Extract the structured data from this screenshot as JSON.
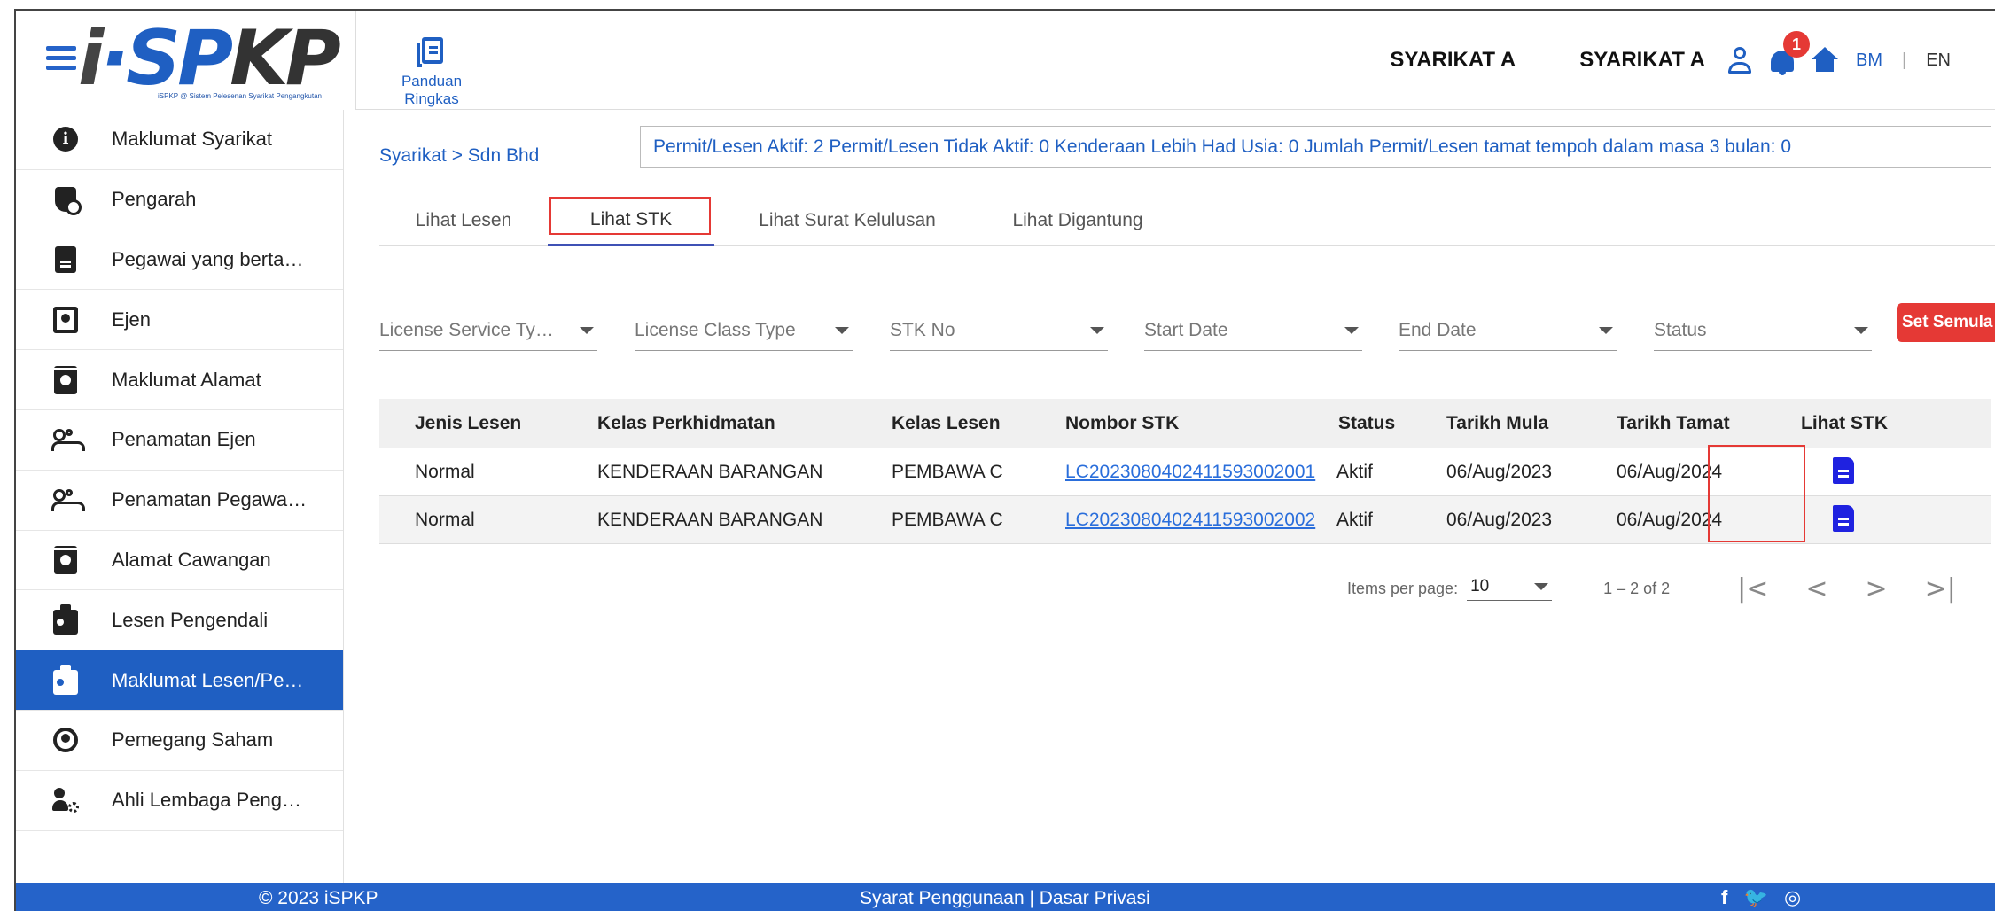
{
  "header": {
    "logo": "iSPKP",
    "logo_sub": "iSPKP @ Sistem Pelesenan Syarikat Pengangkutan",
    "guide_label": "Panduan Ringkas",
    "company_1": "SYARIKAT A",
    "company_2": "SYARIKAT A",
    "notification_count": "1",
    "lang_bm": "BM",
    "lang_sep": "|",
    "lang_en": "EN"
  },
  "sidebar": {
    "items": [
      {
        "label": "Maklumat Syarikat",
        "icon": "info-icon"
      },
      {
        "label": "Pengarah",
        "icon": "shield-user-icon"
      },
      {
        "label": "Pegawai yang berta…",
        "icon": "document-person-icon"
      },
      {
        "label": "Ejen",
        "icon": "contact-card-icon"
      },
      {
        "label": "Maklumat Alamat",
        "icon": "badge-icon"
      },
      {
        "label": "Penamatan Ejen",
        "icon": "people-icon"
      },
      {
        "label": "Penamatan Pegawa…",
        "icon": "people-icon"
      },
      {
        "label": "Alamat Cawangan",
        "icon": "badge-icon"
      },
      {
        "label": "Lesen Pengendali",
        "icon": "id-badge-icon"
      },
      {
        "label": "Maklumat Lesen/Pe…",
        "icon": "id-badge-icon",
        "active": true
      },
      {
        "label": "Pemegang Saham",
        "icon": "person-circle-icon"
      },
      {
        "label": "Ahli Lembaga Peng…",
        "icon": "user-gear-icon"
      }
    ]
  },
  "main": {
    "breadcrumb": "Syarikat > Sdn Bhd",
    "stats": "Permit/Lesen Aktif: 2  Permit/Lesen Tidak Aktif: 0  Kenderaan Lebih Had Usia: 0  Jumlah Permit/Lesen tamat tempoh dalam masa 3 bulan: 0",
    "tabs": [
      "Lihat Lesen",
      "Lihat STK",
      "Lihat Surat Kelulusan",
      "Lihat Digantung"
    ],
    "active_tab": "Lihat STK",
    "filters": [
      "License Service Ty…",
      "License Class Type",
      "STK No",
      "Start Date",
      "End Date",
      "Status"
    ],
    "reset_label": "Set Semula",
    "table": {
      "headers": [
        "Jenis Lesen",
        "Kelas Perkhidmatan",
        "Kelas Lesen",
        "Nombor STK",
        "Status",
        "Tarikh Mula",
        "Tarikh Tamat",
        "Lihat STK"
      ],
      "rows": [
        [
          "Normal",
          "KENDERAAN BARANGAN",
          "PEMBAWA C",
          "LC202308040241159300200​1",
          "Aktif",
          "06/Aug/2023",
          "06/Aug/2024"
        ],
        [
          "Normal",
          "KENDERAAN BARANGAN",
          "PEMBAWA C",
          "LC2023080402411593002002",
          "Aktif",
          "06/Aug/2023",
          "06/Aug/2024"
        ]
      ]
    },
    "pager": {
      "items_per_page_label": "Items per page:",
      "items_per_page": "10",
      "range": "1 – 2 of 2",
      "first": "|<",
      "prev": "<",
      "next": ">",
      "last": ">|"
    }
  },
  "footer": {
    "copyright": "© 2023 iSPKP",
    "links": "Syarat Penggunaan | Dasar Privasi",
    "social": "f 🐦 ◎"
  },
  "colors": {
    "brand_blue": "#1f5fc2",
    "alert_red": "#e53935",
    "link_blue": "#2a6edb"
  }
}
